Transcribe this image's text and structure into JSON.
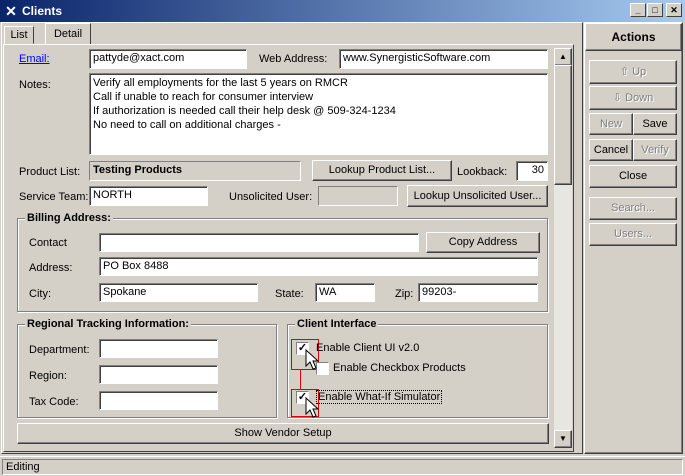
{
  "window": {
    "title": "Clients",
    "icon": "x-app-icon"
  },
  "tabs": [
    {
      "label": "List"
    },
    {
      "label": "Detail"
    }
  ],
  "email": {
    "label": "Email:",
    "value": "pattyde@xact.com"
  },
  "web": {
    "label": "Web Address:",
    "value": "www.SynergisticSoftware.com"
  },
  "notes": {
    "label": "Notes:",
    "lines": [
      "Verify all employments for the last 5 years on RMCR",
      "Call if unable to reach for consumer interview",
      "If authorization is needed call their help desk @ 509-324-1234",
      "No need to call on additional charges -"
    ]
  },
  "product": {
    "label": "Product List:",
    "value": "Testing Products",
    "lookup_button": "Lookup Product List...",
    "lookback_label": "Lookback:",
    "lookback_value": "30"
  },
  "service": {
    "label": "Service Team:",
    "value": "NORTH",
    "unsolicited_label": "Unsolicited User:",
    "unsolicited_value": "",
    "lookup_unsolicited_button": "Lookup Unsolicited User..."
  },
  "billing": {
    "title": "Billing Address:",
    "contact_label": "Contact",
    "contact_value": "",
    "copy_button": "Copy Address",
    "address_label": "Address:",
    "address_value": "PO Box 8488",
    "city_label": "City:",
    "city_value": "Spokane",
    "state_label": "State:",
    "state_value": "WA",
    "zip_label": "Zip:",
    "zip_value": "99203-"
  },
  "regional": {
    "title": "Regional Tracking Information:",
    "department_label": "Department:",
    "department_value": "",
    "region_label": "Region:",
    "region_value": "",
    "taxcode_label": "Tax Code:",
    "taxcode_value": ""
  },
  "client_interface": {
    "title": "Client Interface",
    "enable_ui_label": "Enable Client UI v2.0",
    "enable_ui_checked": true,
    "enable_checkbox_products_label": "Enable Checkbox Products",
    "enable_checkbox_products_checked": false,
    "enable_whatif_label": "Enable What-If Simulator",
    "enable_whatif_checked": true
  },
  "vendor_button": "Show Vendor Setup",
  "actions": {
    "title": "Actions",
    "up": "Up",
    "down": "Down",
    "new": "New",
    "save": "Save",
    "cancel": "Cancel",
    "verify": "Verify",
    "close": "Close",
    "search": "Search...",
    "users": "Users..."
  },
  "status": {
    "text": "Editing"
  }
}
